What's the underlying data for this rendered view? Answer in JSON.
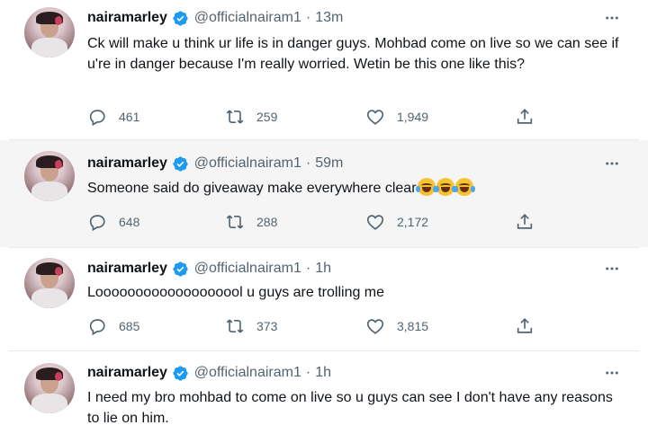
{
  "tweets": [
    {
      "name": "nairamarley",
      "handle": "@officialnairam1",
      "separator": "·",
      "time": "13m",
      "text": "Ck will make u think ur life is in danger guys. Mohbad come on live so we can see if u're in danger because I'm really worried. Wetin be this one like this?",
      "replies": "461",
      "retweets": "259",
      "likes": "1,949"
    },
    {
      "name": "nairamarley",
      "handle": "@officialnairam1",
      "separator": "·",
      "time": "59m",
      "text": "Someone said do giveaway make everywhere clear",
      "emoji_count": 3,
      "replies": "648",
      "retweets": "288",
      "likes": "2,172"
    },
    {
      "name": "nairamarley",
      "handle": "@officialnairam1",
      "separator": "·",
      "time": "1h",
      "text": "Looooooooooooooooool u guys are trolling me",
      "replies": "685",
      "retweets": "373",
      "likes": "3,815"
    },
    {
      "name": "nairamarley",
      "handle": "@officialnairam1",
      "separator": "·",
      "time": "1h",
      "text": "I need my bro mohbad to come on live so u guys can see I don't have any reasons to lie on him."
    }
  ],
  "icons": {
    "verified": "verified-badge-icon",
    "more": "more-dots-icon",
    "reply": "reply-icon",
    "retweet": "retweet-icon",
    "like": "like-icon",
    "share": "share-icon",
    "emoji": "face-with-tears-of-joy-emoji"
  },
  "colors": {
    "verified": "#1d9bf0",
    "text": "#0f1419",
    "muted": "#536471",
    "shaded_background": "#f5f5f5"
  }
}
